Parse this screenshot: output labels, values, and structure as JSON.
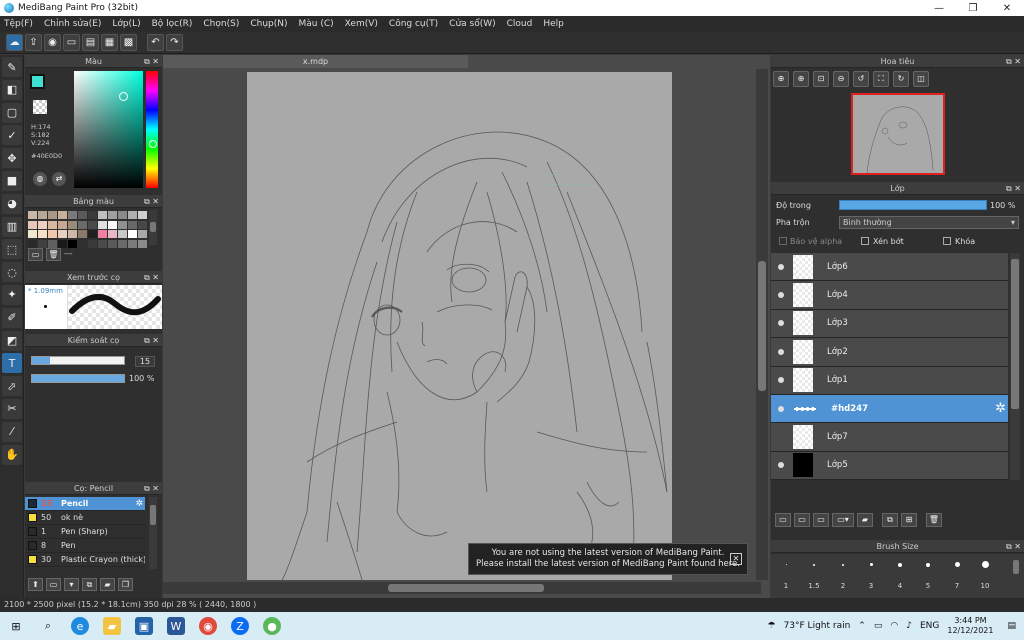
{
  "window": {
    "title": "MediBang Paint Pro (32bit)",
    "minimize": "—",
    "maximize": "❐",
    "close": "✕"
  },
  "menu": [
    "Tệp(F)",
    "Chỉnh sửa(E)",
    "Lớp(L)",
    "Bộ lọc(R)",
    "Chọn(S)",
    "Chụp(N)",
    "Màu (C)",
    "Xem(V)",
    "Công cụ(T)",
    "Cửa sổ(W)",
    "Cloud",
    "Help"
  ],
  "color_panel": {
    "title": "Màu",
    "h": "H:174",
    "s": "S:182",
    "v": "V:224",
    "hex": "#40E0D0",
    "fg_color": "#40e0d0"
  },
  "palette_panel": {
    "title": "Bảng màu",
    "dash": "---",
    "colors": [
      "#c9b8a8",
      "#b8a898",
      "#a89888",
      "#c8b098",
      "#7a7a7a",
      "#5a5a5a",
      "#3a3a3a",
      "#c0c0c0",
      "#a0a0a0",
      "#8a8a8a",
      "#b0b0b0",
      "#d0d0d0",
      "#e8c8b8",
      "#f0d0c0",
      "#d8b8a0",
      "#c8a890",
      "#9a8a7a",
      "#6a6a6a",
      "#4a4a4a",
      "#e0e0e0",
      "#f8f8f8",
      "#909090",
      "#686868",
      "#484848",
      "#f0e8d0",
      "#f8e0c8",
      "#f0c8b0",
      "#e8d0c0",
      "#d0b8a8",
      "#8a7a6a",
      "#202020",
      "#f080a0",
      "#e8b8c8",
      "#c8c8c8",
      "#ffffff",
      "#a8a8a8",
      "#2a2a2a",
      "#404040",
      "#606060",
      "#1a1a1a",
      "#000000",
      "#303030",
      "#3a3a3a",
      "#4a4a4a",
      "#5a5a5a",
      "#6a6a6a",
      "#7a7a7a",
      "#8a8a8a"
    ]
  },
  "preview_panel": {
    "title": "Xem trước cọ",
    "size": "* 1.09mm"
  },
  "brush_control": {
    "title": "Kiểm soát cọ",
    "size_value": "15",
    "size_fraction": 0.2,
    "opacity_value": "100 %",
    "opacity_fraction": 1.0
  },
  "brush_panel": {
    "title": "Cọ: Pencil",
    "items": [
      {
        "num": "15",
        "name": "Pencil",
        "color": "#1a2a3a",
        "selected": true
      },
      {
        "num": "50",
        "name": "ok nè",
        "color": "#f5e040"
      },
      {
        "num": "1",
        "name": "Pen (Sharp)",
        "color": "#2a2a2a"
      },
      {
        "num": "8",
        "name": "Pen",
        "color": "#2a2a2a"
      },
      {
        "num": "30",
        "name": "Plastic Crayon (thick)",
        "color": "#f5e040"
      }
    ]
  },
  "canvas": {
    "tab": "x.mdp"
  },
  "notification": {
    "line1": "You are not using the latest version of MediBang Paint.",
    "line2": "Please install the latest version of MediBang Paint found here.",
    "close": "✕"
  },
  "navigator": {
    "title": "Hoa tiêu"
  },
  "layer_panel": {
    "title": "Lớp",
    "opacity_label": "Độ trong",
    "opacity_value": "100 %",
    "blend_label": "Pha trộn",
    "blend_value": "Bình thường",
    "protect_alpha": "Bảo vệ alpha",
    "clipping": "Xén bớt",
    "lock": "Khóa",
    "layers": [
      {
        "name": "Lớp6",
        "thumb": "check"
      },
      {
        "name": "Lớp4",
        "thumb": "check"
      },
      {
        "name": "Lớp3",
        "thumb": "check"
      },
      {
        "name": "Lớp2",
        "thumb": "check"
      },
      {
        "name": "Lớp1",
        "thumb": "check"
      },
      {
        "name": "#hd247",
        "thumb": "bar",
        "selected": true
      },
      {
        "name": "Lớp7",
        "thumb": "check"
      },
      {
        "name": "Lớp5",
        "thumb": "black"
      }
    ]
  },
  "brush_size_panel": {
    "title": "Brush Size",
    "sizes": [
      "1",
      "1.5",
      "2",
      "3",
      "4",
      "5",
      "7",
      "10"
    ]
  },
  "statusbar": {
    "text": "2100 * 2500 pixel   (15.2 * 18.1cm)   350 dpi   28 %   ( 2440, 1800 )"
  },
  "taskbar": {
    "weather": "73°F  Light rain",
    "lang": "ENG",
    "time": "3:44 PM",
    "date": "12/12/2021"
  }
}
